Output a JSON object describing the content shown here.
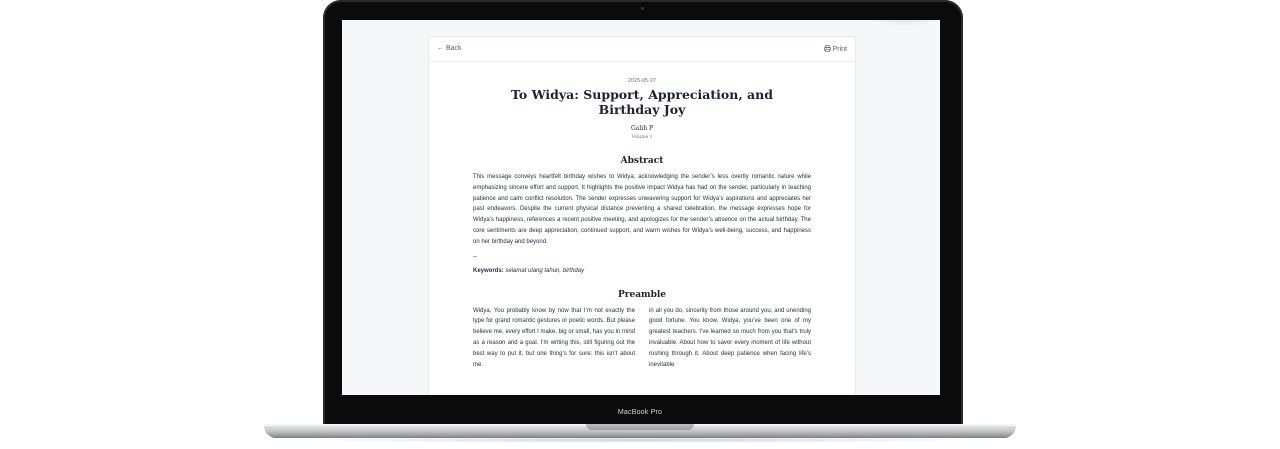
{
  "device_label": "MacBook Pro",
  "toolbar": {
    "back_label": "Back",
    "print_label": "Print"
  },
  "document": {
    "date": "2025-05-27",
    "title": "To Widya: Support, Appreciation, and Birthday Joy",
    "author": "Galih P",
    "volume": "Volume 1",
    "abstract_heading": "Abstract",
    "abstract_text": "This message conveys heartfelt birthday wishes to Widya, acknowledging the sender’s less overtly romantic nature while emphasizing sincere effort and support. It highlights the positive impact Widya has had on the sender, particularly in teaching patience and calm conflict resolution. The sender expresses unwavering support for Widya’s aspirations and appreciates her past endeavors. Despite the current physical distance preventing a shared celebration, the message expresses hope for Widya’s happiness, references a recent positive meeting, and apologizes for the sender’s absence on the actual birthday. The core sentiments are deep appreciation, continued support, and warm wishes for Widya’s well-being, success, and happiness on her birthday and beyond.",
    "separator": "--",
    "keywords_label": "Keywords:",
    "keywords_value": "selamat ulang tahun, birthday",
    "preamble_heading": "Preamble",
    "preamble_col1": "Widya, You probably know by now that I’m not exactly the type for grand romantic gestures or poetic words. But please believe me, every effort I make, big or small, has you in mind as a reason and a goal. I’m writing this, still figuring out the best way to put it, but one thing’s for sure: this isn’t about me.",
    "preamble_col2": "in all you do, sincerity from those around you, and unending good fortune. You know, Widya, you’ve been one of my greatest teachers. I’ve learned so much from you that’s truly invaluable. About how to savor every moment of life without rushing through it. About deep patience when facing life’s inevitable"
  },
  "icons": {
    "back": "arrow-left-icon",
    "print": "printer-icon"
  }
}
